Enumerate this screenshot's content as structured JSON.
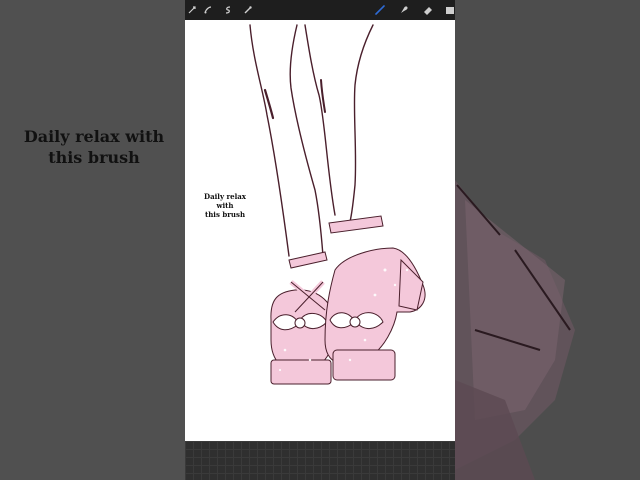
{
  "caption": {
    "line1": "Daily relax with",
    "line2": "this brush"
  },
  "canvas_caption": {
    "line1": "Daily relax with",
    "line2": "this brush"
  },
  "toolbar": {
    "left_tools": [
      "adjustments-icon",
      "selection-icon",
      "transform-icon",
      "eyedropper-icon"
    ],
    "right_tools": [
      "brush-icon",
      "smudge-icon",
      "eraser-icon",
      "layers-icon"
    ],
    "active_tool": "brush-icon",
    "active_color": "#2e6bd6"
  },
  "colors": {
    "shoe_pink": "#f4c8da",
    "line": "#4a1f2c"
  }
}
